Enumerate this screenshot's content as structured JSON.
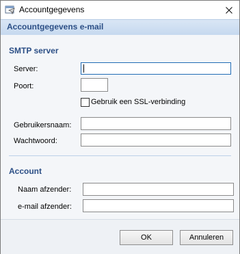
{
  "window": {
    "title": "Accountgegevens",
    "header": "Accountgegevens e-mail"
  },
  "smtp": {
    "section_title": "SMTP server",
    "server_label": "Server:",
    "server_value": "",
    "port_label": "Poort:",
    "port_value": "",
    "ssl_label": "Gebruik een SSL-verbinding",
    "ssl_checked": false,
    "username_label": "Gebruikersnaam:",
    "username_value": "",
    "password_label": "Wachtwoord:",
    "password_value": ""
  },
  "account": {
    "section_title": "Account",
    "sender_name_label": "Naam afzender:",
    "sender_name_value": "",
    "sender_email_label": "e-mail afzender:",
    "sender_email_value": ""
  },
  "buttons": {
    "ok": "OK",
    "cancel": "Annuleren"
  },
  "colors": {
    "accent": "#2c4f86",
    "header_band": "#d9e6f5",
    "focus_border": "#1f6bb5"
  },
  "icons": {
    "app": "mail-window-icon",
    "close": "close-icon"
  }
}
